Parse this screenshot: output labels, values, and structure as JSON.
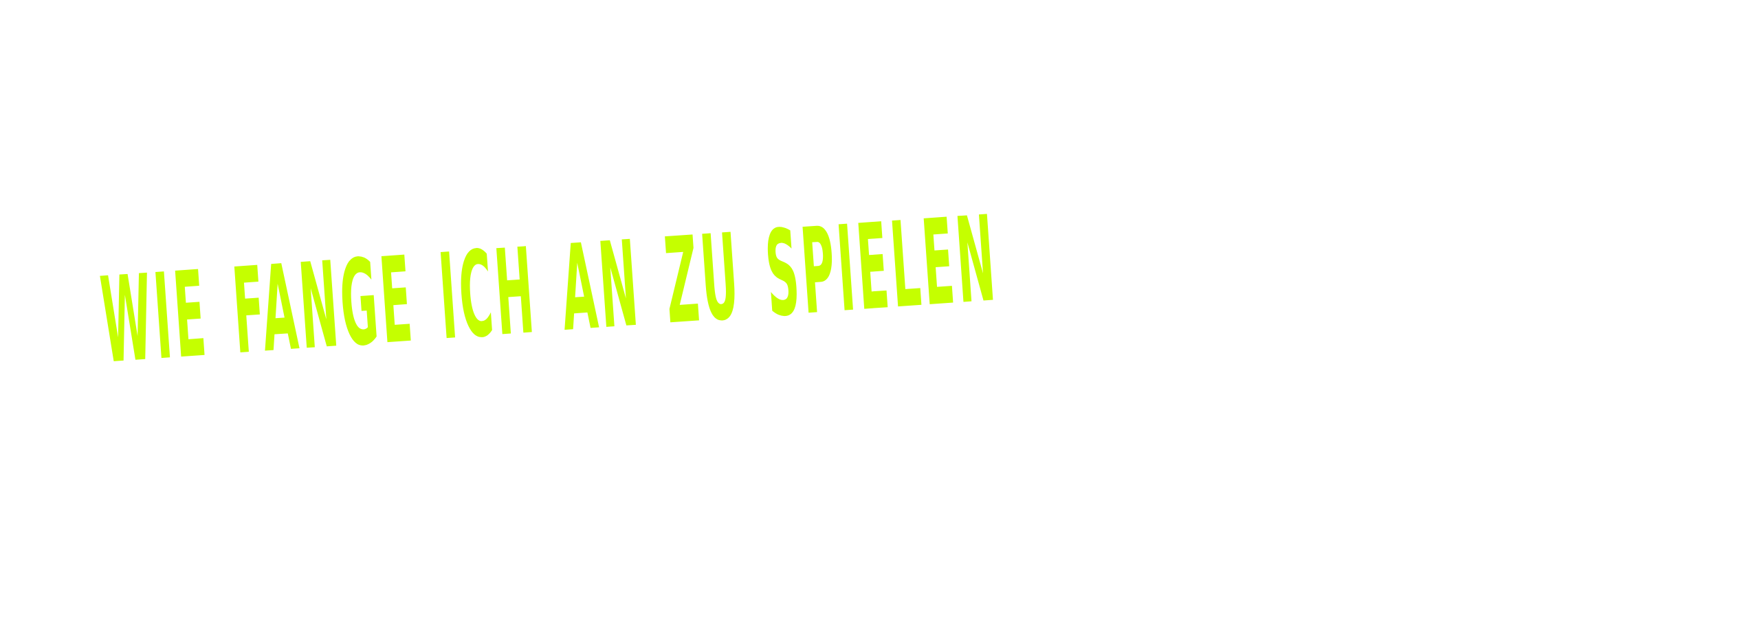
{
  "headline": {
    "text": "WIE FANGE ICH AN ZU SPIELEN"
  },
  "colors": {
    "text": "#c5ff00",
    "background": "#ffffff"
  }
}
